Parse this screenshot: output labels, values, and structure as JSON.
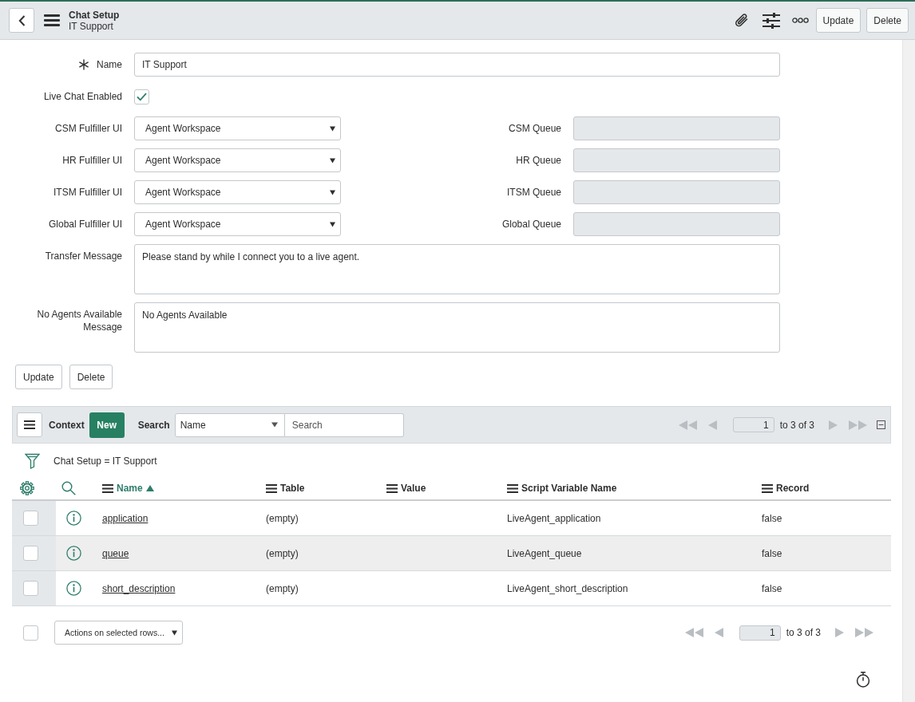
{
  "header": {
    "title": "Chat Setup",
    "subtitle": "IT Support",
    "buttons": [
      "Update",
      "Delete"
    ]
  },
  "form": {
    "name": {
      "label": "Name",
      "required": true,
      "value": "IT Support"
    },
    "live_chat": {
      "label": "Live Chat Enabled",
      "checked": true
    },
    "fulfillers": [
      {
        "label": "CSM Fulfiller UI",
        "value": "Agent Workspace",
        "queue_label": "CSM Queue",
        "queue_readonly": true
      },
      {
        "label": "HR Fulfiller UI",
        "value": "Agent Workspace",
        "queue_label": "HR Queue",
        "queue_readonly": true
      },
      {
        "label": "ITSM Fulfiller UI",
        "value": "Agent Workspace",
        "queue_label": "ITSM Queue",
        "queue_readonly": true
      },
      {
        "label": "Global Fulfiller UI",
        "value": "Agent Workspace",
        "queue_label": "Global Queue",
        "queue_readonly": true
      }
    ],
    "transfer_message": {
      "label": "Transfer Message",
      "value": "Please stand by while I connect you to a live agent."
    },
    "no_agents_message": {
      "label": "No Agents Available Message",
      "value": "No Agents Available"
    },
    "buttons": [
      "Update",
      "Delete"
    ]
  },
  "related_list": {
    "toolbar": {
      "context": "Context",
      "new_button": "New",
      "search_label": "Search",
      "search_field": "Name",
      "search_placeholder": "Search",
      "page": "1",
      "range": "to 3 of 3"
    },
    "filter": "Chat Setup = IT Support",
    "columns": [
      {
        "label": "Name",
        "sorted": true
      },
      {
        "label": "Table",
        "sorted": false
      },
      {
        "label": "Value",
        "sorted": false
      },
      {
        "label": "Script Variable Name",
        "sorted": false
      },
      {
        "label": "Record",
        "sorted": false
      }
    ],
    "rows": [
      {
        "name": "application",
        "table": "(empty)",
        "script_variable_name": "LiveAgent_application",
        "record": "false",
        "checked": false,
        "highlighted": false
      },
      {
        "name": "queue",
        "table": "(empty)",
        "script_variable_name": "LiveAgent_queue",
        "record": "false",
        "checked": false,
        "highlighted": true
      },
      {
        "name": "short_description",
        "table": "(empty)",
        "script_variable_name": "LiveAgent_short_description",
        "record": "false",
        "checked": false,
        "highlighted": false
      }
    ],
    "footer": {
      "checked": false,
      "actions_select": "Actions on selected rows...",
      "page": "1",
      "range": "to 3 of 3"
    }
  }
}
